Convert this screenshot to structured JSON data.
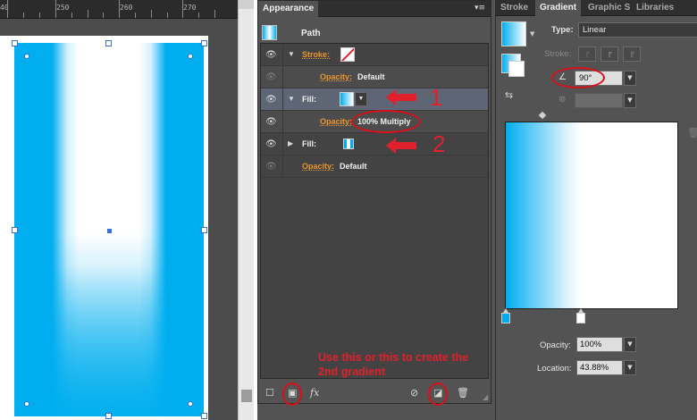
{
  "ruler": {
    "ticks": [
      "40",
      "250",
      "260",
      "270"
    ]
  },
  "appearance": {
    "tabs": {
      "active": "Appearance"
    },
    "panel_menu": "▾≡",
    "header": {
      "label": "Path"
    },
    "rows": {
      "stroke_label": "Stroke:",
      "stroke_opacity_label": "Opacity:",
      "stroke_opacity_value": "Default",
      "fill1_label": "Fill:",
      "fill1_opacity_label": "Opacity:",
      "fill1_opacity_value": "100% Multiply",
      "fill2_label": "Fill:",
      "opacity_label": "Opacity:",
      "opacity_value": "Default"
    },
    "bottom": {
      "fx_label": "fx"
    }
  },
  "annotations": {
    "num1": "1",
    "num2": "2",
    "note": "Use this or this to create the 2nd gradient"
  },
  "gradient_panel": {
    "tabs": [
      "Stroke",
      "Gradient",
      "Graphic S",
      "Libraries"
    ],
    "type_label": "Type:",
    "type_value": "Linear",
    "stroke_label": "Stroke:",
    "angle_value": "90°",
    "opacity_label": "Opacity:",
    "opacity_value": "100%",
    "location_label": "Location:",
    "location_value": "43.88%",
    "gradient_stops": [
      {
        "color": "#00aeef",
        "location_pct": 0
      },
      {
        "color": "#ffffff",
        "location_pct": 43.88
      }
    ],
    "angle_degrees": 90
  },
  "colors": {
    "accent_blue": "#00aeef",
    "annotation_red": "#e0202a",
    "label_orange": "#e8962e"
  },
  "icons": [
    "eye-icon",
    "disclosure-triangle-icon",
    "none-swatch-icon",
    "gradient-swatch-icon",
    "new-layer-icon",
    "fx-icon",
    "clear-icon",
    "duplicate-icon",
    "trash-icon",
    "angle-icon",
    "aspect-icon",
    "reverse-gradient-icon"
  ]
}
